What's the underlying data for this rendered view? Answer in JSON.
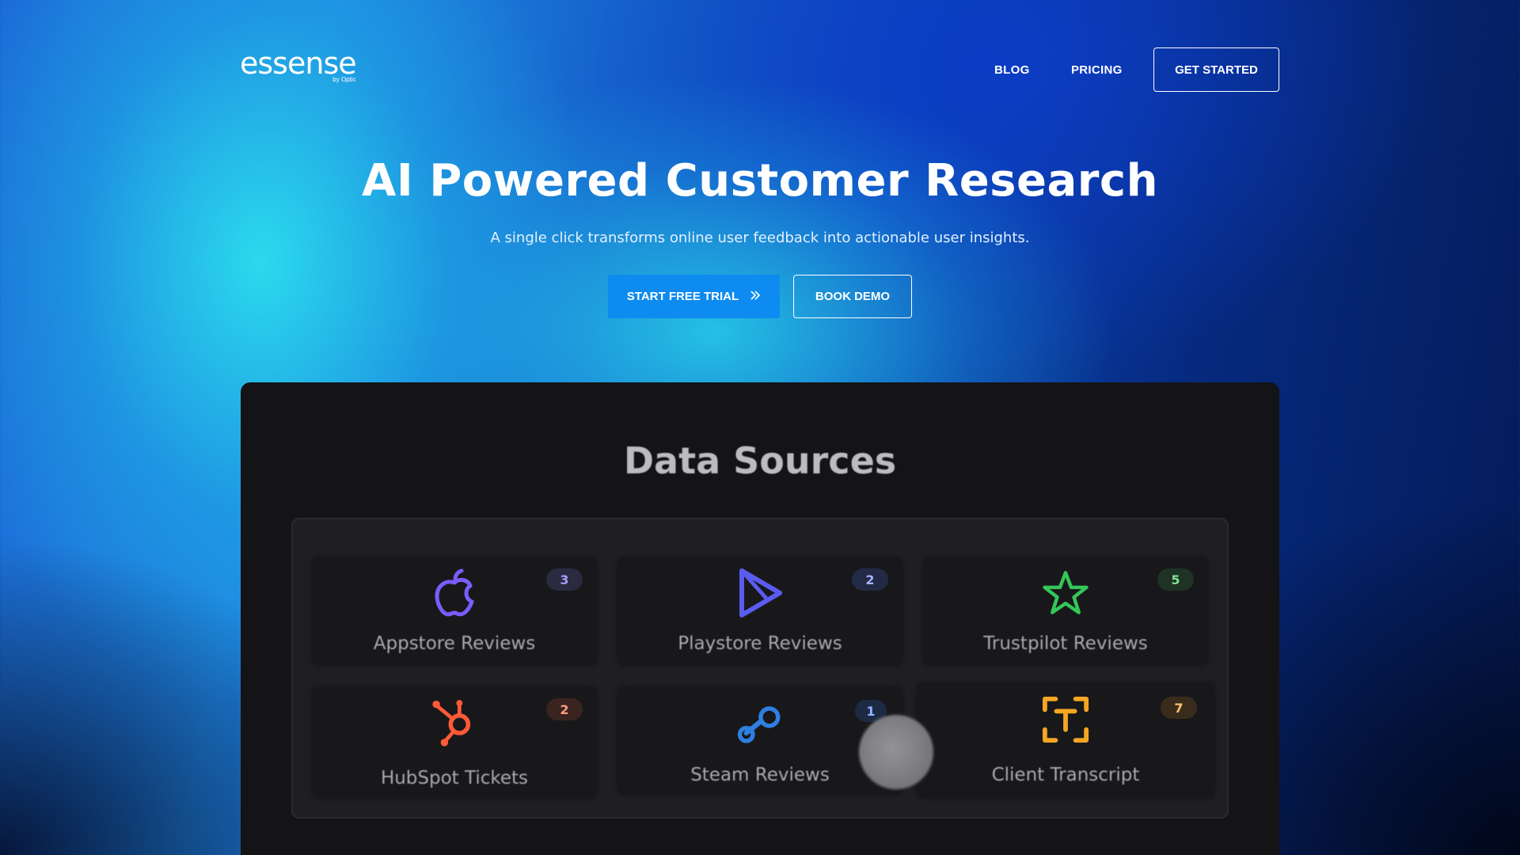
{
  "header": {
    "logo_text": "essense",
    "logo_sub": "by Optic",
    "nav": {
      "blog": "BLOG",
      "pricing": "PRICING"
    },
    "cta": "GET STARTED"
  },
  "hero": {
    "title": "AI Powered Customer Research",
    "subtitle": "A single click transforms online user feedback into actionable user insights.",
    "primary_button": "START FREE TRIAL",
    "secondary_button": "BOOK DEMO"
  },
  "data_sources": {
    "title": "Data Sources",
    "items": [
      {
        "label": "Appstore Reviews",
        "count": "3",
        "icon": "apple-icon",
        "color": "#7b5cff"
      },
      {
        "label": "Playstore Reviews",
        "count": "2",
        "icon": "play-icon",
        "color": "#5a5cf0"
      },
      {
        "label": "Trustpilot Reviews",
        "count": "5",
        "icon": "star-icon",
        "color": "#34c759"
      },
      {
        "label": "HubSpot Tickets",
        "count": "2",
        "icon": "hubspot-icon",
        "color": "#ff5a36"
      },
      {
        "label": "Steam Reviews",
        "count": "1",
        "icon": "steam-icon",
        "color": "#2f7fe0"
      },
      {
        "label": "Client Transcript",
        "count": "7",
        "icon": "transcript-icon",
        "color": "#f5a623"
      }
    ]
  },
  "colors": {
    "accent": "#0d8bf0",
    "panel": "#141416"
  }
}
